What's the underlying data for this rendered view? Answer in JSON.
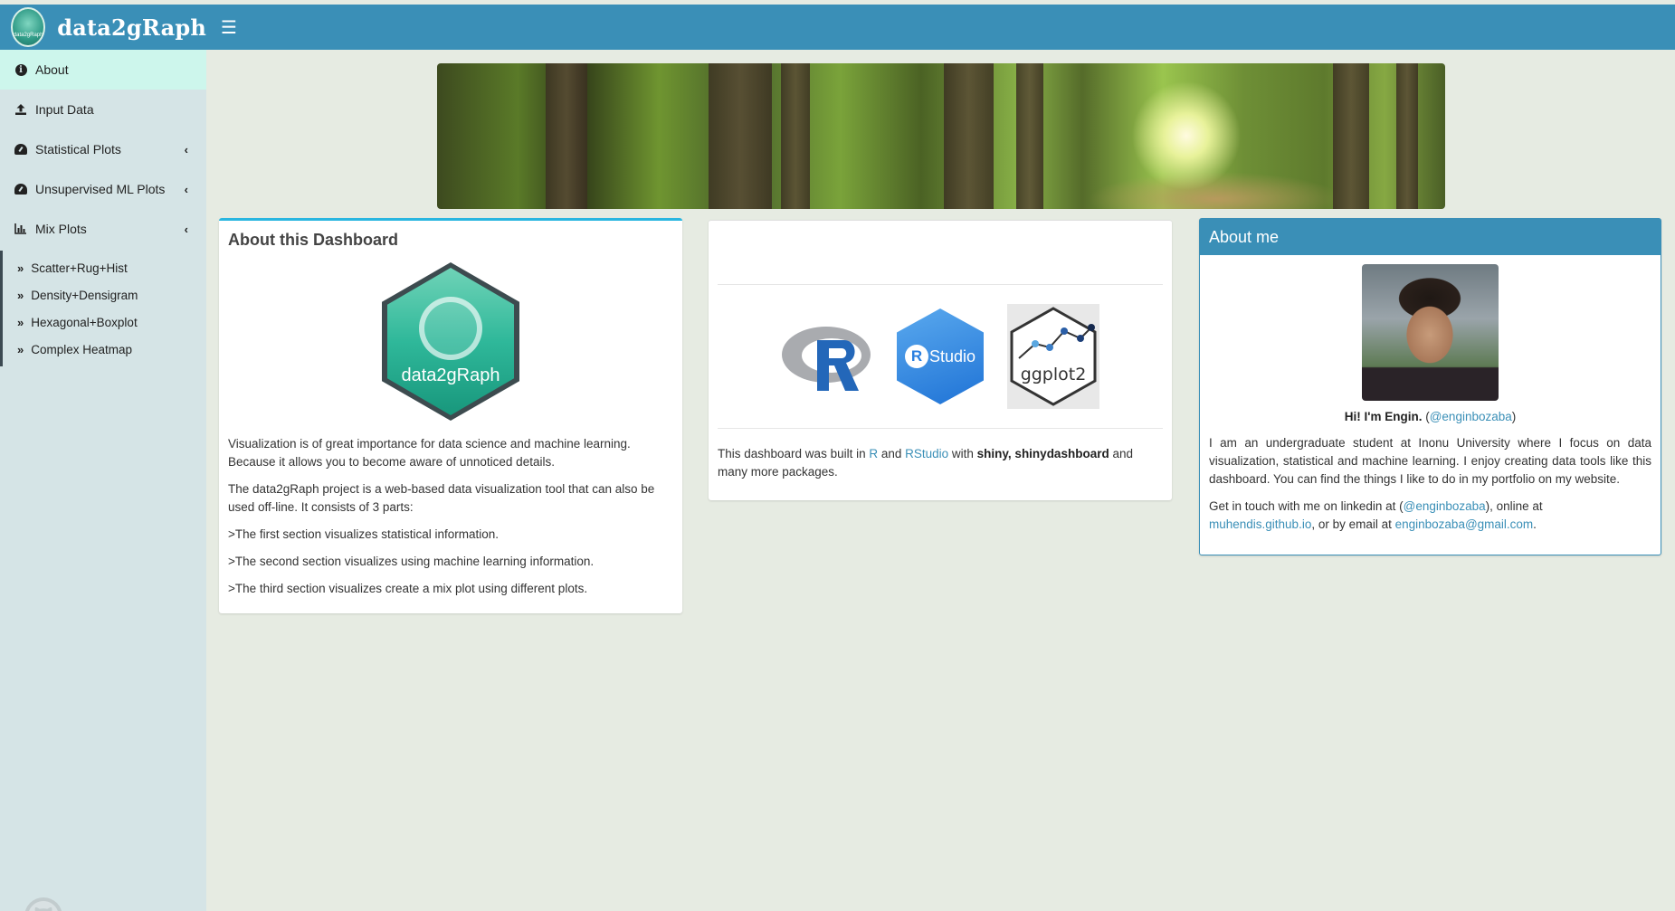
{
  "header": {
    "app_title": "data2gRaph",
    "logo_text": "data2gRaph"
  },
  "sidebar": {
    "items": [
      {
        "label": "About",
        "icon": "info-icon",
        "active": true
      },
      {
        "label": "Input Data",
        "icon": "upload-icon"
      },
      {
        "label": "Statistical Plots",
        "icon": "dashboard-icon",
        "expandable": true
      },
      {
        "label": "Unsupervised ML Plots",
        "icon": "dashboard-icon",
        "expandable": true
      },
      {
        "label": "Mix Plots",
        "icon": "bar-chart-icon",
        "expandable": true
      }
    ],
    "mix_submenu": [
      {
        "label": "Scatter+Rug+Hist"
      },
      {
        "label": "Density+Densigram"
      },
      {
        "label": "Hexagonal+Boxplot"
      },
      {
        "label": "Complex Heatmap"
      }
    ]
  },
  "about_dashboard": {
    "title": "About this Dashboard",
    "logo_text": "data2gRaph",
    "p1": "Visualization is of great importance for data science and machine learning. Because it allows you to become aware of unnoticed details.",
    "p2": "The data2gRaph project is a web-based data visualization tool that can also be used off-line. It consists of 3 parts:",
    "p3": ">The first section visualizes statistical information.",
    "p4": ">The second section visualizes using machine learning information.",
    "p5": ">The third section visualizes create a mix plot using different plots."
  },
  "built_with": {
    "rstudio_logo_text": "Studio",
    "ggplot_logo_text": "ggplot2",
    "text_a": "This dashboard was built in ",
    "link_r": "R",
    "text_b": " and ",
    "link_rstudio": "RStudio",
    "text_c": " with ",
    "bold": "shiny, shinydashboard",
    "text_d": " and many more packages."
  },
  "about_me": {
    "title": "About me",
    "greeting_bold": "Hi! I'm Engin.",
    "greeting_open": " (",
    "handle": "@enginbozaba",
    "greeting_close": ")",
    "bio": "I am an undergraduate student at Inonu University where I focus on data visualization, statistical and machine learning. I enjoy creating data tools like this dashboard. You can find the things I like to do in my portfolio on my website.",
    "contact_a": "Get in touch with me on linkedin at (",
    "contact_handle": "@enginbozaba",
    "contact_b": "), online at ",
    "website": "muhendis.github.io",
    "contact_c": ", or by email at ",
    "email": "enginbozaba@gmail.com",
    "contact_d": "."
  },
  "colors": {
    "topbar": "#3a8fb7",
    "sidebar": "#d5e4e6",
    "active_item": "#cdf6ec",
    "link": "#3a8fb7",
    "box_accent": "#29b6e0"
  }
}
